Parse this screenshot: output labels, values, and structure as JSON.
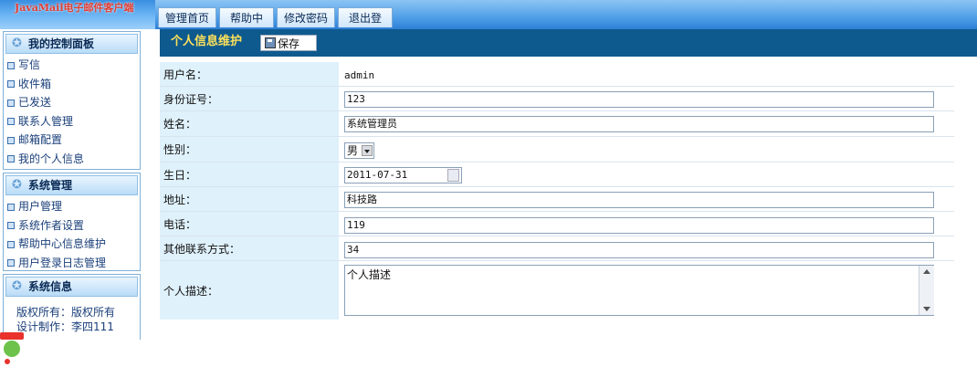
{
  "app": {
    "logo_text": "JavaMail电子邮件客户端"
  },
  "top_nav": [
    "管理首页",
    "帮助中心",
    "修改密码",
    "退出登录"
  ],
  "sidebar": {
    "panels": [
      {
        "title": "我的控制面板",
        "items": [
          "写信",
          "收件箱",
          "已发送",
          "联系人管理",
          "邮箱配置",
          "我的个人信息"
        ]
      },
      {
        "title": "系统管理",
        "items": [
          "用户管理",
          "系统作者设置",
          "帮助中心信息维护",
          "用户登录日志管理"
        ]
      },
      {
        "title": "系统信息",
        "items": [
          "版权所有：版权所有",
          "设计制作：李四111"
        ]
      }
    ]
  },
  "main": {
    "title": "个人信息维护",
    "save_label": "保存",
    "fields": {
      "username": {
        "label": "用户名：",
        "value": "admin"
      },
      "id_number": {
        "label": "身份证号：",
        "value": "123"
      },
      "name": {
        "label": "姓名：",
        "value": "系统管理员"
      },
      "gender": {
        "label": "性别：",
        "value": "男"
      },
      "birthday": {
        "label": "生日：",
        "value": "2011-07-31"
      },
      "address": {
        "label": "地址：",
        "value": "科技路"
      },
      "phone": {
        "label": "电话：",
        "value": "119"
      },
      "other_contact": {
        "label": "其他联系方式：",
        "value": "34"
      },
      "description": {
        "label": "个人描述：",
        "value": "个人描述"
      }
    }
  }
}
